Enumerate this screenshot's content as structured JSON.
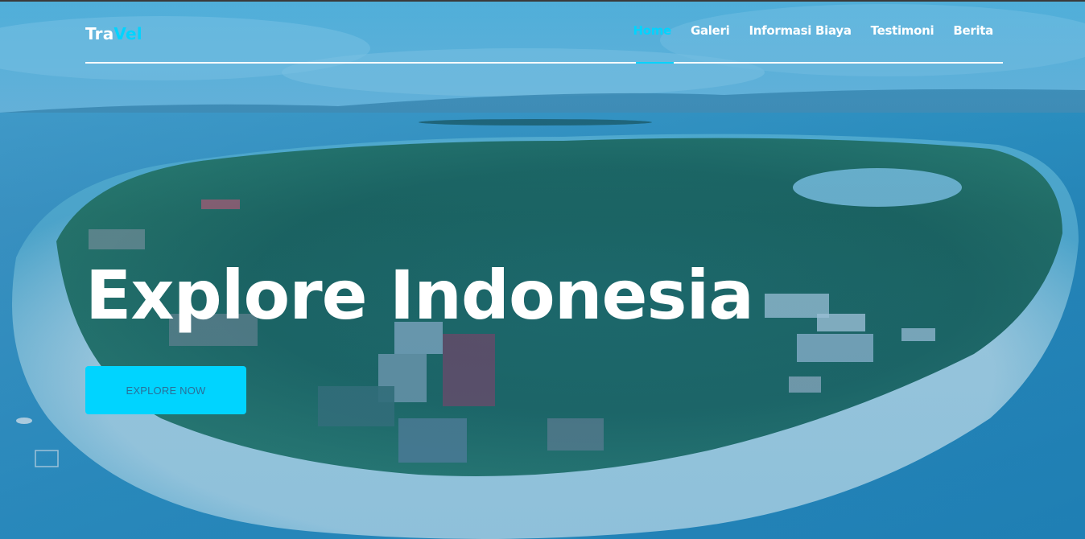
{
  "brand": {
    "logo_part1": "Tra",
    "logo_part2": "Vel"
  },
  "nav": {
    "items": [
      {
        "label": "Home",
        "active": true
      },
      {
        "label": "Galeri",
        "active": false
      },
      {
        "label": "Informasi Biaya",
        "active": false
      },
      {
        "label": "Testimoni",
        "active": false
      },
      {
        "label": "Berita",
        "active": false
      }
    ]
  },
  "hero": {
    "headline": "Explore Indonesia",
    "cta_label": "EXPLORE NOW",
    "background": "aerial-island-photo"
  },
  "colors": {
    "accent": "#00d4ff",
    "white": "#ffffff",
    "button_text": "#2a6f9a"
  }
}
